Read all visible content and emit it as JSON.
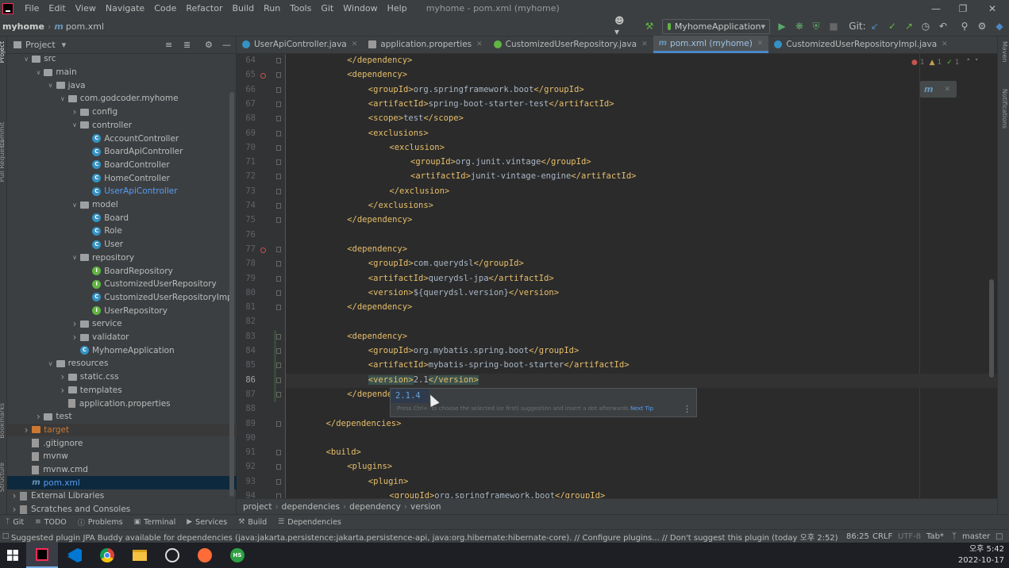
{
  "window": {
    "title": "myhome - pom.xml (myhome)"
  },
  "menu": [
    "File",
    "Edit",
    "View",
    "Navigate",
    "Code",
    "Refactor",
    "Build",
    "Run",
    "Tools",
    "Git",
    "Window",
    "Help"
  ],
  "nav": {
    "project": "myhome",
    "file": "pom.xml",
    "run_config": "MyhomeApplication",
    "git_label": "Git:"
  },
  "project_panel": {
    "title": "Project",
    "rows": [
      {
        "label": "src",
        "depth": 1,
        "kind": "folder",
        "open": true
      },
      {
        "label": "main",
        "depth": 2,
        "kind": "folder",
        "open": true
      },
      {
        "label": "java",
        "depth": 3,
        "kind": "src",
        "open": true
      },
      {
        "label": "com.godcoder.myhome",
        "depth": 4,
        "kind": "folder",
        "open": true
      },
      {
        "label": "config",
        "depth": 5,
        "kind": "folder",
        "open": false
      },
      {
        "label": "controller",
        "depth": 5,
        "kind": "folder",
        "open": true
      },
      {
        "label": "AccountController",
        "depth": 6,
        "kind": "class"
      },
      {
        "label": "BoardApiController",
        "depth": 6,
        "kind": "class"
      },
      {
        "label": "BoardController",
        "depth": 6,
        "kind": "class"
      },
      {
        "label": "HomeController",
        "depth": 6,
        "kind": "class"
      },
      {
        "label": "UserApiController",
        "depth": 6,
        "kind": "class",
        "color": "blue"
      },
      {
        "label": "model",
        "depth": 5,
        "kind": "folder",
        "open": true
      },
      {
        "label": "Board",
        "depth": 6,
        "kind": "class"
      },
      {
        "label": "Role",
        "depth": 6,
        "kind": "class"
      },
      {
        "label": "User",
        "depth": 6,
        "kind": "class"
      },
      {
        "label": "repository",
        "depth": 5,
        "kind": "folder",
        "open": true
      },
      {
        "label": "BoardRepository",
        "depth": 6,
        "kind": "interface"
      },
      {
        "label": "CustomizedUserRepository",
        "depth": 6,
        "kind": "interface"
      },
      {
        "label": "CustomizedUserRepositoryImpl",
        "depth": 6,
        "kind": "class"
      },
      {
        "label": "UserRepository",
        "depth": 6,
        "kind": "interface"
      },
      {
        "label": "service",
        "depth": 5,
        "kind": "folder",
        "open": false
      },
      {
        "label": "validator",
        "depth": 5,
        "kind": "folder",
        "open": false
      },
      {
        "label": "MyhomeApplication",
        "depth": 5,
        "kind": "class"
      },
      {
        "label": "resources",
        "depth": 3,
        "kind": "res",
        "open": true
      },
      {
        "label": "static.css",
        "depth": 4,
        "kind": "folder",
        "open": false
      },
      {
        "label": "templates",
        "depth": 4,
        "kind": "folder",
        "open": false
      },
      {
        "label": "application.properties",
        "depth": 4,
        "kind": "file"
      },
      {
        "label": "test",
        "depth": 2,
        "kind": "folder",
        "open": false
      },
      {
        "label": "target",
        "depth": 1,
        "kind": "target",
        "open": false,
        "color": "orange"
      },
      {
        "label": ".gitignore",
        "depth": 1,
        "kind": "file"
      },
      {
        "label": "mvnw",
        "depth": 1,
        "kind": "file"
      },
      {
        "label": "mvnw.cmd",
        "depth": 1,
        "kind": "file"
      },
      {
        "label": "pom.xml",
        "depth": 1,
        "kind": "maven",
        "color": "blue",
        "selected": true
      },
      {
        "label": "External Libraries",
        "depth": 0,
        "kind": "lib",
        "open": false
      },
      {
        "label": "Scratches and Consoles",
        "depth": 0,
        "kind": "lib",
        "open": false
      }
    ]
  },
  "tabs": [
    {
      "label": "UserApiController.java",
      "kind": "class"
    },
    {
      "label": "application.properties",
      "kind": "props"
    },
    {
      "label": "CustomizedUserRepository.java",
      "kind": "interface"
    },
    {
      "label": "pom.xml (myhome)",
      "kind": "maven",
      "active": true
    },
    {
      "label": "CustomizedUserRepositoryImpl.java",
      "kind": "class"
    }
  ],
  "editor": {
    "current_line": "86",
    "inspections": {
      "errors": "1",
      "warnings": "1",
      "ok": "1"
    },
    "lines": [
      {
        "n": "64",
        "i": 2,
        "t": "</dependency>"
      },
      {
        "n": "65",
        "i": 2,
        "t": "<dependency>"
      },
      {
        "n": "66",
        "i": 3,
        "t": "<groupId>",
        "v": "org.springframework.boot",
        "e": "</groupId>"
      },
      {
        "n": "67",
        "i": 3,
        "t": "<artifactId>",
        "v": "spring-boot-starter-test",
        "e": "</artifactId>"
      },
      {
        "n": "68",
        "i": 3,
        "t": "<scope>",
        "v": "test",
        "e": "</scope>"
      },
      {
        "n": "69",
        "i": 3,
        "t": "<exclusions>"
      },
      {
        "n": "70",
        "i": 4,
        "t": "<exclusion>"
      },
      {
        "n": "71",
        "i": 5,
        "t": "<groupId>",
        "v": "org.junit.vintage",
        "e": "</groupId>"
      },
      {
        "n": "72",
        "i": 5,
        "t": "<artifactId>",
        "v": "junit-vintage-engine",
        "e": "</artifactId>"
      },
      {
        "n": "73",
        "i": 4,
        "t": "</exclusion>"
      },
      {
        "n": "74",
        "i": 3,
        "t": "</exclusions>"
      },
      {
        "n": "75",
        "i": 2,
        "t": "</dependency>"
      },
      {
        "n": "76",
        "i": 0,
        "t": ""
      },
      {
        "n": "77",
        "i": 2,
        "t": "<dependency>"
      },
      {
        "n": "78",
        "i": 3,
        "t": "<groupId>",
        "v": "com.querydsl",
        "e": "</groupId>"
      },
      {
        "n": "79",
        "i": 3,
        "t": "<artifactId>",
        "v": "querydsl-jpa",
        "e": "</artifactId>"
      },
      {
        "n": "80",
        "i": 3,
        "t": "<version>",
        "v": "${querydsl.version}",
        "e": "</version>"
      },
      {
        "n": "81",
        "i": 2,
        "t": "</dependency>"
      },
      {
        "n": "82",
        "i": 0,
        "t": ""
      },
      {
        "n": "83",
        "i": 2,
        "t": "<dependency>"
      },
      {
        "n": "84",
        "i": 3,
        "t": "<groupId>",
        "v": "org.mybatis.spring.boot",
        "e": "</groupId>"
      },
      {
        "n": "85",
        "i": 3,
        "t": "<artifactId>",
        "v": "mybatis-spring-boot-starter",
        "e": "</artifactId>"
      },
      {
        "n": "86",
        "i": 3,
        "t": "<version>",
        "v": "2.1",
        "e": "</version>"
      },
      {
        "n": "87",
        "i": 2,
        "t": "</dependency>"
      },
      {
        "n": "88",
        "i": 0,
        "t": ""
      },
      {
        "n": "89",
        "i": 1,
        "t": "</dependencies>"
      },
      {
        "n": "90",
        "i": 0,
        "t": ""
      },
      {
        "n": "91",
        "i": 1,
        "t": "<build>"
      },
      {
        "n": "92",
        "i": 2,
        "t": "<plugins>"
      },
      {
        "n": "93",
        "i": 3,
        "t": "<plugin>"
      },
      {
        "n": "94",
        "i": 4,
        "t": "<groupId>",
        "v": "org.springframework.boot",
        "e": "</groupId>"
      }
    ]
  },
  "completion": {
    "item": "2.1.4",
    "tip": "Press Ctrl+. to choose the selected (or first) suggestion and insert a dot afterwards",
    "next_tip": "Next Tip"
  },
  "breadcrumb": [
    "project",
    "dependencies",
    "dependency",
    "version"
  ],
  "tool_windows": [
    "Git",
    "TODO",
    "Problems",
    "Terminal",
    "Services",
    "Build",
    "Dependencies"
  ],
  "left_labels": [
    "Project",
    "Commit",
    "Pull Requests",
    "Bookmarks",
    "Structure"
  ],
  "right_labels": [
    "Maven",
    "Notifications"
  ],
  "status": {
    "message": "Suggested plugin JPA Buddy available for dependencies (java:jakarta.persistence:jakarta.persistence-api, java:org.hibernate:hibernate-core). // Configure plugins... // Don't suggest this plugin (today 오후 2:52)",
    "position": "86:25",
    "line_sep": "CRLF",
    "encoding": "UTF-8",
    "indent": "Tab*",
    "branch": "master"
  },
  "taskbar": {
    "time": "오후 5:42",
    "date": "2022-10-17",
    "hs_label": "HS"
  }
}
